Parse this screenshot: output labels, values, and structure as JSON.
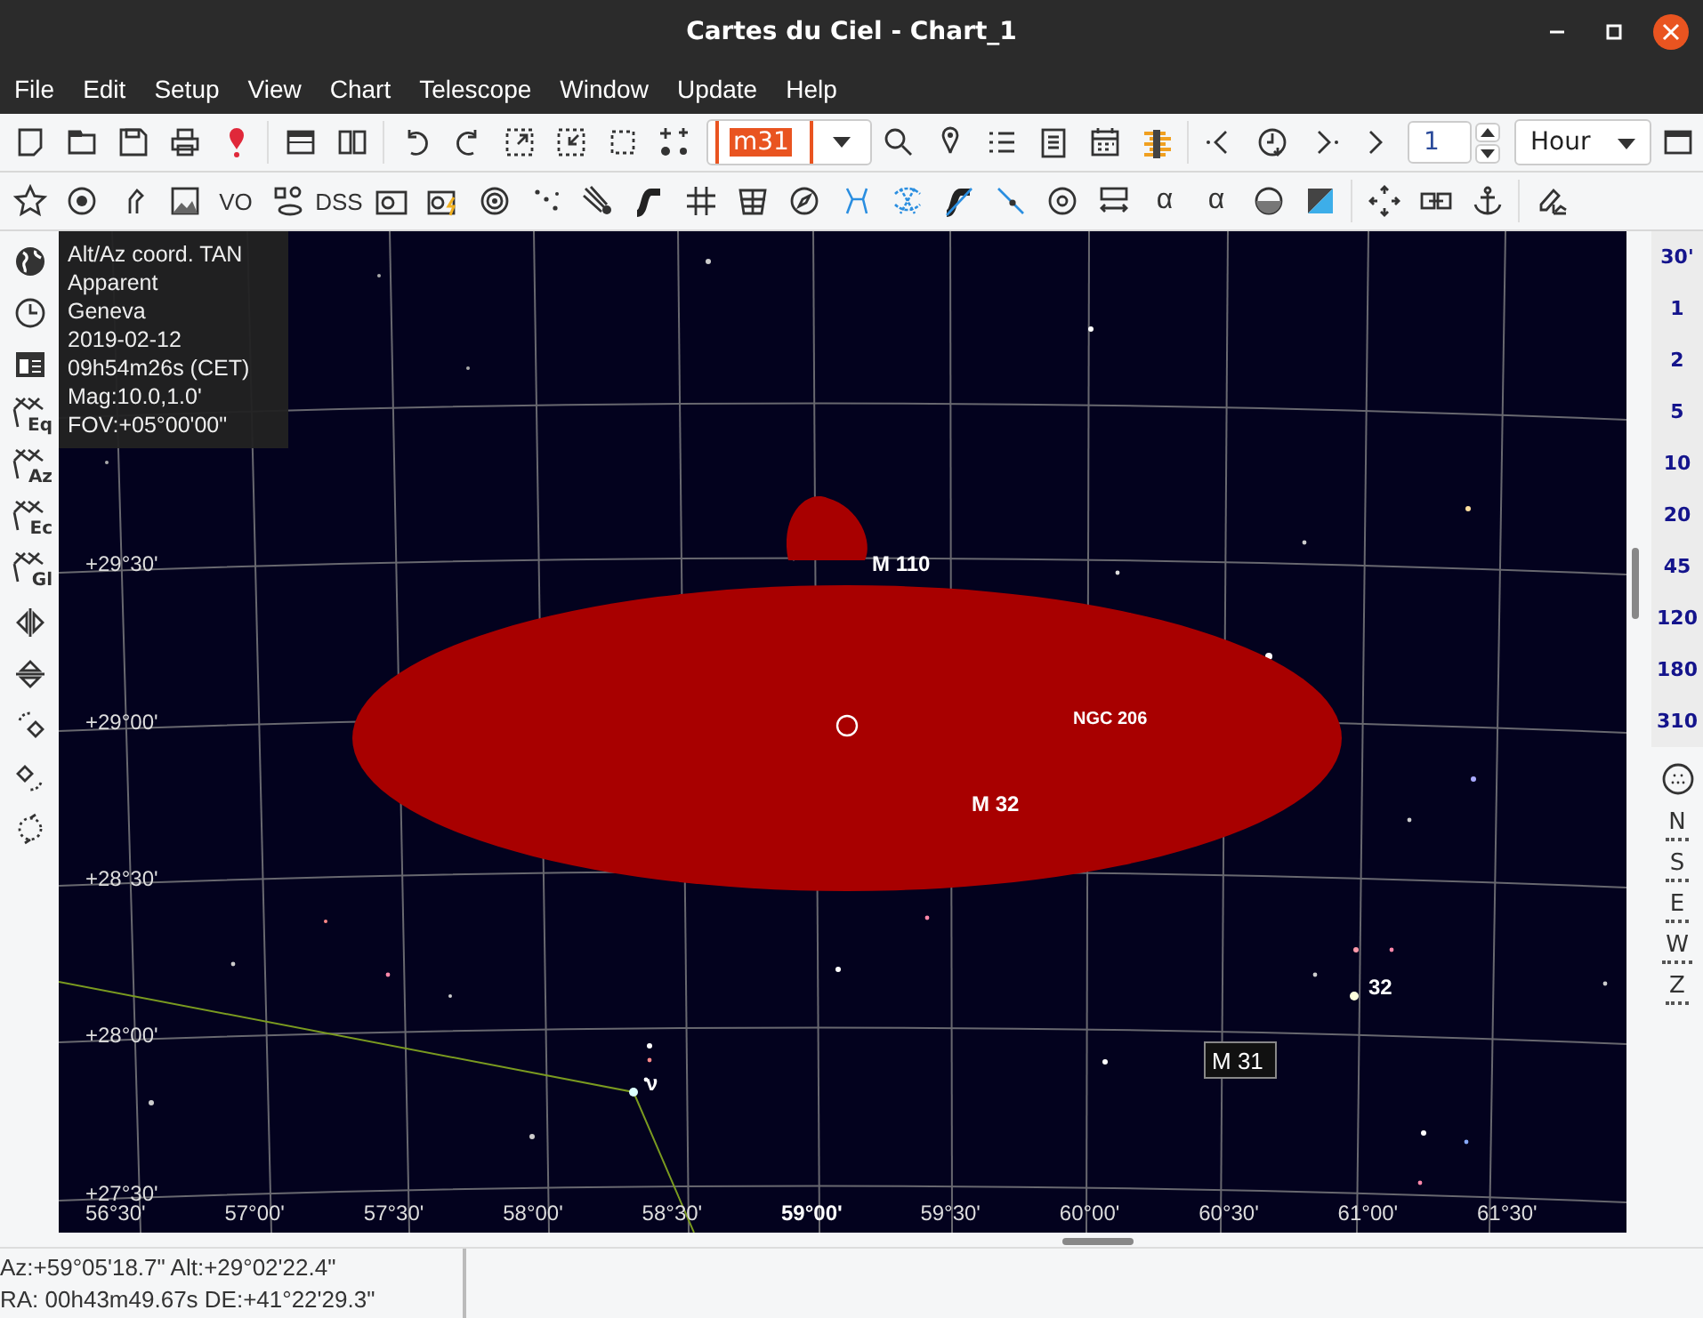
{
  "window": {
    "title": "Cartes du Ciel - Chart_1"
  },
  "menu": [
    "File",
    "Edit",
    "Setup",
    "View",
    "Chart",
    "Telescope",
    "Window",
    "Update",
    "Help"
  ],
  "search": {
    "value": "m31"
  },
  "step": {
    "value": "1",
    "unit": "Hour"
  },
  "toolbar_labels": [
    "VO",
    "DSS",
    "α",
    "α"
  ],
  "grid_buttons": [
    "Eq",
    "Az",
    "Ec",
    "Gl"
  ],
  "info_lines": [
    "Alt/Az coord. TAN",
    "Apparent",
    "Geneva",
    "2019-02-12",
    "09h54m26s (CET)",
    "Mag:10.0,1.0'",
    "FOV:+05°00'00\""
  ],
  "dec_labels": [
    "+29°30'",
    "+29°00'",
    "+28°30'",
    "+28°00'",
    "+27°30'"
  ],
  "ra_labels": [
    "56°30'",
    "57°00'",
    "57°30'",
    "58°00'",
    "58°30'",
    "59°00'",
    "59°30'",
    "60°00'",
    "60°30'",
    "61°00'",
    "61°30'"
  ],
  "objects": [
    {
      "label": "M 110"
    },
    {
      "label": "NGC 206"
    },
    {
      "label": "M 32"
    },
    {
      "label": "32"
    },
    {
      "label": "ν"
    }
  ],
  "selected_object": "M 31",
  "fov_buttons": [
    "30'",
    "1",
    "2",
    "5",
    "10",
    "20",
    "45",
    "120",
    "180",
    "310"
  ],
  "orientation_buttons": [
    "N",
    "S",
    "E",
    "W",
    "Z"
  ],
  "status": [
    "Az:+59°05'18.7\" Alt:+29°02'22.4\"",
    "RA: 00h43m49.67s DE:+41°22'29.3\""
  ]
}
